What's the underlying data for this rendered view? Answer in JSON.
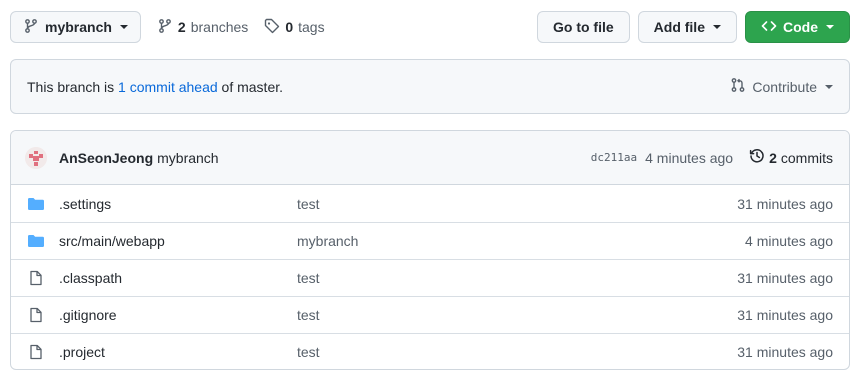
{
  "toolbar": {
    "branch_name": "mybranch",
    "branches_count": "2",
    "branches_label": "branches",
    "tags_count": "0",
    "tags_label": "tags",
    "go_to_file": "Go to file",
    "add_file": "Add file",
    "code": "Code"
  },
  "notice": {
    "prefix": "This branch is ",
    "link": "1 commit ahead",
    "suffix": " of master.",
    "contribute": "Contribute"
  },
  "latest_commit": {
    "author": "AnSeonJeong",
    "message": "mybranch",
    "sha": "dc211aa",
    "time": "4 minutes ago",
    "commits_count": "2",
    "commits_label": "commits"
  },
  "files": [
    {
      "type": "folder",
      "name": ".settings",
      "message": "test",
      "time": "31 minutes ago"
    },
    {
      "type": "folder",
      "name": "src/main/webapp",
      "message": "mybranch",
      "time": "4 minutes ago"
    },
    {
      "type": "file",
      "name": ".classpath",
      "message": "test",
      "time": "31 minutes ago"
    },
    {
      "type": "file",
      "name": ".gitignore",
      "message": "test",
      "time": "31 minutes ago"
    },
    {
      "type": "file",
      "name": ".project",
      "message": "test",
      "time": "31 minutes ago"
    }
  ],
  "colors": {
    "accent_link": "#0969da",
    "green_button": "#2da44e",
    "folder": "#54aeff"
  }
}
